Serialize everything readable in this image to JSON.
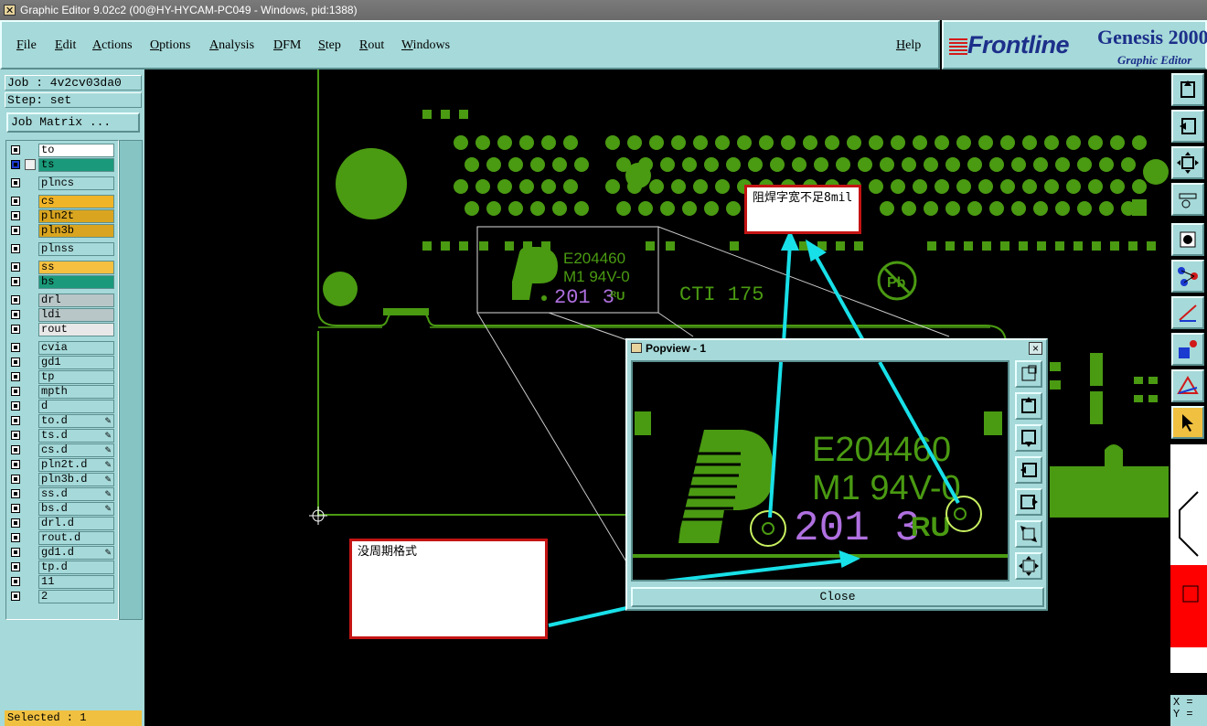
{
  "window": {
    "title": "Graphic Editor 9.02c2 (00@HY-HYCAM-PC049 - Windows, pid:1388)"
  },
  "menu": {
    "items": [
      "File",
      "Edit",
      "Actions",
      "Options",
      "Analysis",
      "DFM",
      "Step",
      "Rout",
      "Windows"
    ],
    "help": "Help"
  },
  "branding": {
    "company": "Frontline",
    "product": "Genesis 2000",
    "subtitle": "Graphic Editor"
  },
  "job": {
    "job_label": "Job : 4v2cv03da0",
    "step_label": "Step: set",
    "job_matrix_button": "Job Matrix ..."
  },
  "layers": [
    {
      "name": "to",
      "color": "#ffffff"
    },
    {
      "name": "ts",
      "color": "#1a9a7a",
      "work": true
    },
    {
      "name": "plncs",
      "color": "#a6d9d9"
    },
    {
      "name": "cs",
      "color": "#f0b428"
    },
    {
      "name": "pln2t",
      "color": "#d9a520"
    },
    {
      "name": "pln3b",
      "color": "#d9a520"
    },
    {
      "name": "plnss",
      "color": "#a6d9d9"
    },
    {
      "name": "ss",
      "color": "#f5c040"
    },
    {
      "name": "bs",
      "color": "#1a9a7a"
    },
    {
      "name": "drl",
      "color": "#b8c6c8"
    },
    {
      "name": "ldi",
      "color": "#b8c6c8"
    },
    {
      "name": "rout",
      "color": "#e8e8e8"
    },
    {
      "name": "cvia",
      "color": "#a6d9d9"
    },
    {
      "name": "gd1",
      "color": "#a6d9d9"
    },
    {
      "name": "tp",
      "color": "#a6d9d9"
    },
    {
      "name": "mpth",
      "color": "#a6d9d9"
    },
    {
      "name": "d",
      "color": "#a6d9d9"
    },
    {
      "name": "to.d",
      "color": "#a6d9d9",
      "flag": true
    },
    {
      "name": "ts.d",
      "color": "#a6d9d9",
      "flag": true
    },
    {
      "name": "cs.d",
      "color": "#a6d9d9",
      "flag": true
    },
    {
      "name": "pln2t.d",
      "color": "#a6d9d9",
      "flag": true
    },
    {
      "name": "pln3b.d",
      "color": "#a6d9d9",
      "flag": true
    },
    {
      "name": "ss.d",
      "color": "#a6d9d9",
      "flag": true
    },
    {
      "name": "bs.d",
      "color": "#a6d9d9",
      "flag": true
    },
    {
      "name": "drl.d",
      "color": "#a6d9d9"
    },
    {
      "name": "rout.d",
      "color": "#a6d9d9"
    },
    {
      "name": "gd1.d",
      "color": "#a6d9d9",
      "flag": true
    },
    {
      "name": "tp.d",
      "color": "#a6d9d9"
    },
    {
      "name": "11",
      "color": "#a6d9d9"
    },
    {
      "name": "2",
      "color": "#a6d9d9"
    }
  ],
  "status": {
    "selected": "Selected : 1",
    "x_label": "X =",
    "y_label": "Y ="
  },
  "board": {
    "marking_line1": "E204460",
    "marking_line2": "M1 94V-0",
    "date_code": "201 3",
    "cti_text": "CTI 175",
    "pb_symbol": "Pb"
  },
  "popview": {
    "title": "Popview - 1",
    "close_label": "Close",
    "close_x": "×"
  },
  "notes": {
    "top_note": "阻焊字宽不足8mil",
    "bottom_note": "没周期格式"
  },
  "colors": {
    "copper": "#4a9a12",
    "silk": "#b070e0",
    "panel": "#a6d9d9",
    "annotation": "#18e0e8"
  }
}
